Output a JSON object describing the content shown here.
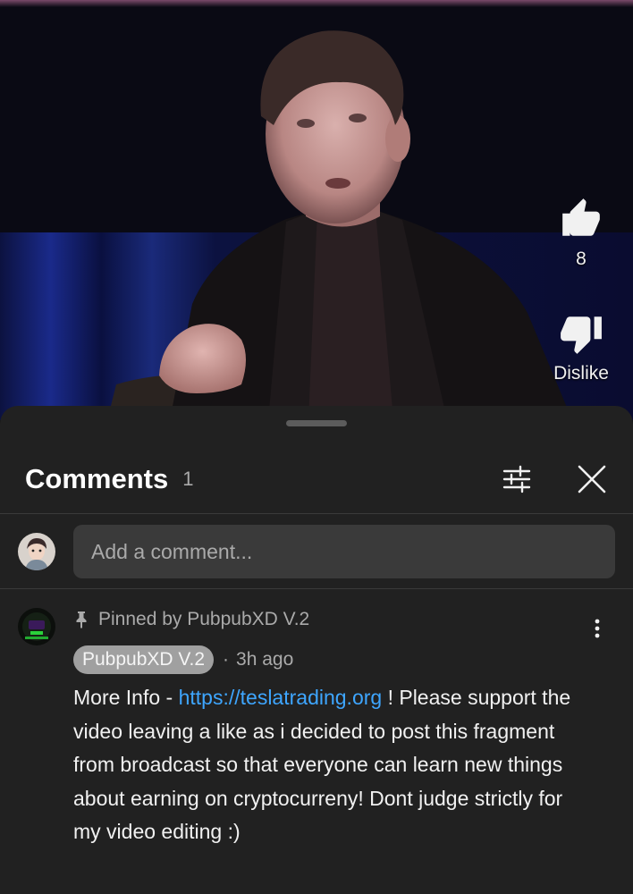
{
  "video": {
    "like": {
      "icon": "thumbs-up-icon",
      "count": "8"
    },
    "dislike": {
      "icon": "thumbs-down-icon",
      "label": "Dislike"
    }
  },
  "comments_sheet": {
    "title": "Comments",
    "count": "1",
    "filter_icon": "sliders-icon",
    "close_icon": "close-icon",
    "add_comment": {
      "placeholder": "Add a comment..."
    },
    "comments": [
      {
        "pinned_text": "Pinned by PubpubXD V.2",
        "author": "PubpubXD V.2",
        "separator": "·",
        "time": "3h ago",
        "text_before_link": "More Info - ",
        "link": "https://teslatrading.org",
        "text_after_link": " ! Please support the video leaving a like as i decided to post this fragment from broadcast so that everyone can learn new things about earning on cryptocurreny! Dont judge strictly for my video editing :)"
      }
    ]
  },
  "colors": {
    "sheet_bg": "#212121",
    "link": "#3ea6ff",
    "muted_text": "#aaaaaa",
    "input_bg": "#3a3a3a"
  }
}
